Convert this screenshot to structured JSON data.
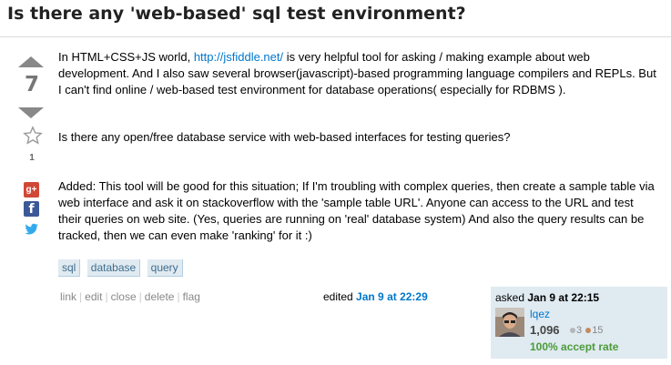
{
  "question": {
    "title": "Is there any 'web-based' sql test environment?",
    "votes": "7",
    "favorites": "1",
    "body": {
      "p1_before": "In HTML+CSS+JS world, ",
      "p1_link": "http://jsfiddle.net/",
      "p1_after": " is very helpful tool for asking / making example about web development. And I also saw several browser(javascript)-based programming language compilers and REPLs. But I can't find online / web-based test environment for database operations( especially for RDBMS ).",
      "p2": "Is there any open/free database service with web-based interfaces for testing queries?",
      "p3": "Added: This tool will be good for this situation; If I'm troubling with complex queries, then create a sample table via web interface and ask it on stackoverflow with the 'sample table URL'. Anyone can access to the URL and test their queries on web site. (Yes, queries are running on 'real' database system) And also the query results can be tracked, then we can even make 'ranking' for it :)"
    },
    "tags": [
      "sql",
      "database",
      "query"
    ],
    "menu": [
      "link",
      "edit",
      "close",
      "delete",
      "flag"
    ],
    "edited": {
      "label": "edited",
      "date": "Jan 9 at 22:29"
    },
    "owner": {
      "asked_label": "asked",
      "asked_date": "Jan 9 at 22:15",
      "name": "lqez",
      "reputation": "1,096",
      "silver": "3",
      "bronze": "15",
      "accept_rate": "100% accept rate"
    }
  },
  "share": {
    "gplus_label": "g+",
    "fb_label": "f"
  },
  "colors": {
    "link": "#0077cc",
    "tag_bg": "#e0eaf1",
    "tag_text": "#3e6d8e",
    "owner_bg": "#e0eaf1",
    "accept": "#4b9b3a"
  }
}
